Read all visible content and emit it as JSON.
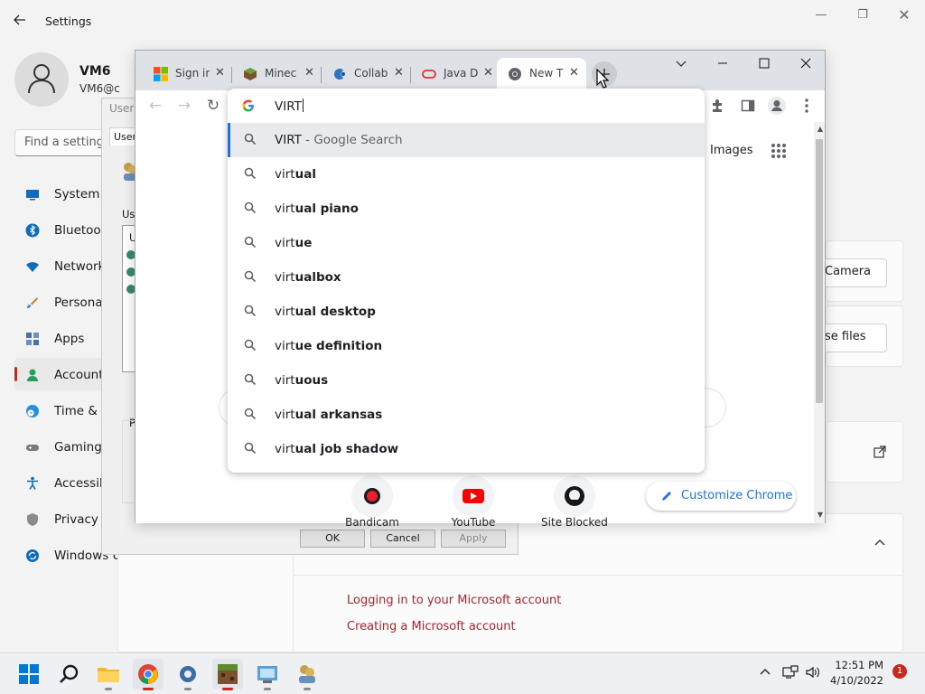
{
  "settings": {
    "title": "Settings",
    "user_name": "VM6",
    "user_email": "VM6@c",
    "search_placeholder": "Find a setting",
    "nav": [
      {
        "label": "System",
        "icon": "monitor-icon"
      },
      {
        "label": "Bluetoot",
        "icon": "bluetooth-icon"
      },
      {
        "label": "Network",
        "icon": "wifi-icon"
      },
      {
        "label": "Personal",
        "icon": "brush-icon"
      },
      {
        "label": "Apps",
        "icon": "apps-icon"
      },
      {
        "label": "Account",
        "icon": "person-icon"
      },
      {
        "label": "Time & l",
        "icon": "clock-globe-icon"
      },
      {
        "label": "Gaming",
        "icon": "gamepad-icon"
      },
      {
        "label": "Accessib",
        "icon": "accessibility-icon"
      },
      {
        "label": "Privacy &",
        "icon": "shield-icon"
      },
      {
        "label": "Windows U",
        "icon": "update-icon"
      }
    ],
    "camera_button": "Camera",
    "files_button": "se files",
    "links": [
      "Logging in to your Microsoft account",
      "Creating a Microsoft account"
    ]
  },
  "uac": {
    "caption": "User A",
    "tab": "Users",
    "users_label": "Use",
    "list_header": "U",
    "section_p": "P",
    "ok": "OK",
    "cancel": "Cancel",
    "apply": "Apply"
  },
  "chrome": {
    "tabs": [
      {
        "title": "Sign in",
        "icon": "microsoft-icon"
      },
      {
        "title": "Minec",
        "icon": "minecraft-icon"
      },
      {
        "title": "Collab",
        "icon": "collab-icon"
      },
      {
        "title": "Java D",
        "icon": "oracle-icon"
      },
      {
        "title": "New T",
        "icon": "chrome-icon"
      }
    ],
    "omnibox_text": "VIRT",
    "suggestions": [
      {
        "prefix": "VIRT",
        "rest": "",
        "hint": " - Google Search"
      },
      {
        "prefix": "virt",
        "rest": "ual",
        "hint": ""
      },
      {
        "prefix": "virt",
        "rest": "ual piano",
        "hint": ""
      },
      {
        "prefix": "virt",
        "rest": "ue",
        "hint": ""
      },
      {
        "prefix": "virt",
        "rest": "ualbox",
        "hint": ""
      },
      {
        "prefix": "virt",
        "rest": "ual desktop",
        "hint": ""
      },
      {
        "prefix": "virt",
        "rest": "ue definition",
        "hint": ""
      },
      {
        "prefix": "virt",
        "rest": "uous",
        "hint": ""
      },
      {
        "prefix": "virt",
        "rest": "ual arkansas",
        "hint": ""
      },
      {
        "prefix": "virt",
        "rest": "ual job shadow",
        "hint": ""
      }
    ],
    "images_link": "Images",
    "shortcuts": [
      "Bandicam",
      "YouTube",
      "Site Blocked"
    ],
    "customize": "Customize Chrome"
  },
  "taskbar": {
    "time": "12:51 PM",
    "date": "4/10/2022",
    "notifications": "1",
    "apps": [
      "start-icon",
      "search-icon",
      "file-explorer-icon",
      "chrome-icon",
      "settings-icon",
      "minecraft-icon",
      "control-panel-icon",
      "user-accounts-icon"
    ]
  },
  "colors": {
    "accent": "#1a73e8",
    "windows_accent": "#c42b1c",
    "link": "#a4262c"
  }
}
